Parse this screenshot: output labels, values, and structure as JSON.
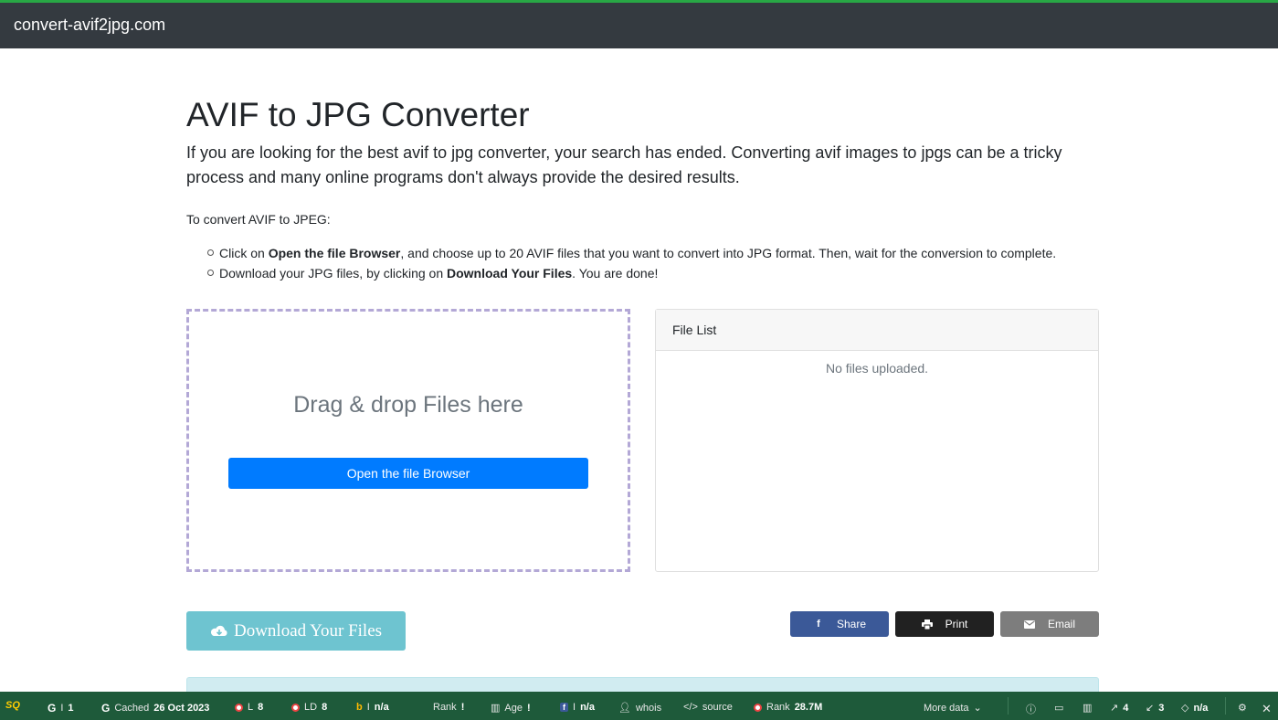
{
  "header": {
    "brand": "convert-avif2jpg.com"
  },
  "main": {
    "title": "AVIF to JPG Converter",
    "lead": "If you are looking for the best avif to jpg converter, your search has ended. Converting avif images to jpgs can be a tricky process and many online programs don't always provide the desired results.",
    "instructions_title": "To convert AVIF to JPEG:",
    "steps": [
      {
        "pre": "Click on ",
        "bold": "Open the file Browser",
        "post": ", and choose up to 20 AVIF files that you want to convert into JPG format. Then, wait for the conversion to complete."
      },
      {
        "pre": "Download your JPG files, by clicking on ",
        "bold": "Download Your Files",
        "post": ". You are done!"
      }
    ]
  },
  "dropzone": {
    "text": "Drag & drop Files here",
    "button": "Open the file Browser"
  },
  "filelist": {
    "title": "File List",
    "empty": "No files uploaded."
  },
  "actions": {
    "download": "Download Your Files",
    "share": "Share",
    "print": "Print",
    "email": "Email"
  },
  "statusbar": {
    "logo": "SQ",
    "google_index": "1",
    "cached_label": "Cached",
    "cached_date": "26 Oct 2023",
    "l_label": "L",
    "l_value": "8",
    "ld_label": "LD",
    "ld_value": "8",
    "bing_value": "n/a",
    "rank_label": "Rank",
    "rank_value": "!",
    "age_label": "Age",
    "age_value": "!",
    "fb_value": "n/a",
    "whois": "whois",
    "source": "source",
    "rank2_label": "Rank",
    "rank2_value": "28.7M",
    "more_data": "More data",
    "ext_links": "4",
    "int_links": "3",
    "diamond_value": "n/a"
  },
  "colors": {
    "topbar": "#343a40",
    "accent_line": "#28a745",
    "primary": "#007bff",
    "info": "#6ec4d0",
    "facebook": "#3b5998",
    "statusbar": "#1e5a3a"
  }
}
